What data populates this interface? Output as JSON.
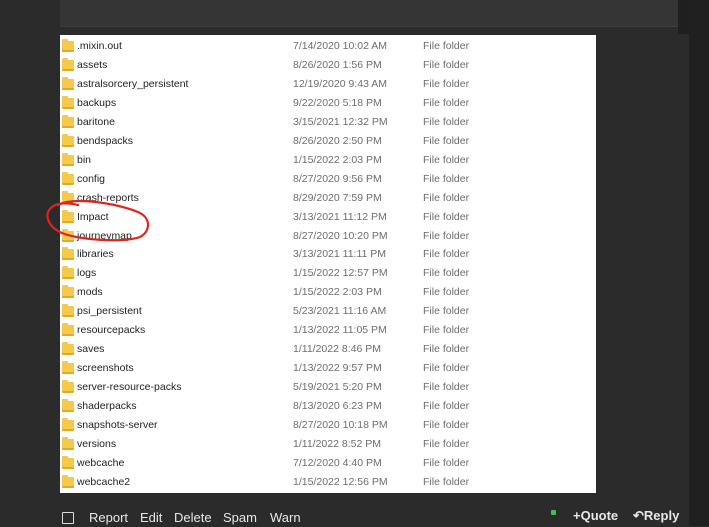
{
  "files": [
    {
      "name": ".mixin.out",
      "date": "7/14/2020 10:02 AM",
      "type": "File folder"
    },
    {
      "name": "assets",
      "date": "8/26/2020 1:56 PM",
      "type": "File folder"
    },
    {
      "name": "astralsorcery_persistent",
      "date": "12/19/2020 9:43 AM",
      "type": "File folder"
    },
    {
      "name": "backups",
      "date": "9/22/2020 5:18 PM",
      "type": "File folder"
    },
    {
      "name": "baritone",
      "date": "3/15/2021 12:32 PM",
      "type": "File folder"
    },
    {
      "name": "bendspacks",
      "date": "8/26/2020 2:50 PM",
      "type": "File folder"
    },
    {
      "name": "bin",
      "date": "1/15/2022 2:03 PM",
      "type": "File folder"
    },
    {
      "name": "config",
      "date": "8/27/2020 9:56 PM",
      "type": "File folder"
    },
    {
      "name": "crash-reports",
      "date": "8/29/2020 7:59 PM",
      "type": "File folder"
    },
    {
      "name": "Impact",
      "date": "3/13/2021 11:12 PM",
      "type": "File folder"
    },
    {
      "name": "journeymap",
      "date": "8/27/2020 10:20 PM",
      "type": "File folder"
    },
    {
      "name": "libraries",
      "date": "3/13/2021 11:11 PM",
      "type": "File folder"
    },
    {
      "name": "logs",
      "date": "1/15/2022 12:57 PM",
      "type": "File folder"
    },
    {
      "name": "mods",
      "date": "1/15/2022 2:03 PM",
      "type": "File folder"
    },
    {
      "name": "psi_persistent",
      "date": "5/23/2021 11:16 AM",
      "type": "File folder"
    },
    {
      "name": "resourcepacks",
      "date": "1/13/2022 11:05 PM",
      "type": "File folder"
    },
    {
      "name": "saves",
      "date": "1/11/2022 8:46 PM",
      "type": "File folder"
    },
    {
      "name": "screenshots",
      "date": "1/13/2022 9:57 PM",
      "type": "File folder"
    },
    {
      "name": "server-resource-packs",
      "date": "5/19/2021 5:20 PM",
      "type": "File folder"
    },
    {
      "name": "shaderpacks",
      "date": "8/13/2020 6:23 PM",
      "type": "File folder"
    },
    {
      "name": "snapshots-server",
      "date": "8/27/2020 10:18 PM",
      "type": "File folder"
    },
    {
      "name": "versions",
      "date": "1/11/2022 8:52 PM",
      "type": "File folder"
    },
    {
      "name": "webcache",
      "date": "7/12/2020 4:40 PM",
      "type": "File folder"
    },
    {
      "name": "webcache2",
      "date": "1/15/2022 12:56 PM",
      "type": "File folder"
    }
  ],
  "footer": {
    "report": "Report",
    "edit": "Edit",
    "delete": "Delete",
    "spam": "Spam",
    "warn": "Warn",
    "quote": "Quote",
    "reply": "Reply"
  },
  "icons": {
    "folder": "folder-icon",
    "quote": "plus-icon",
    "reply": "reply-arrow-icon"
  },
  "colors": {
    "background": "#2b2b2b",
    "annotation": "#e0231f",
    "folder": "#f6c94c",
    "online": "#3cc44a"
  }
}
